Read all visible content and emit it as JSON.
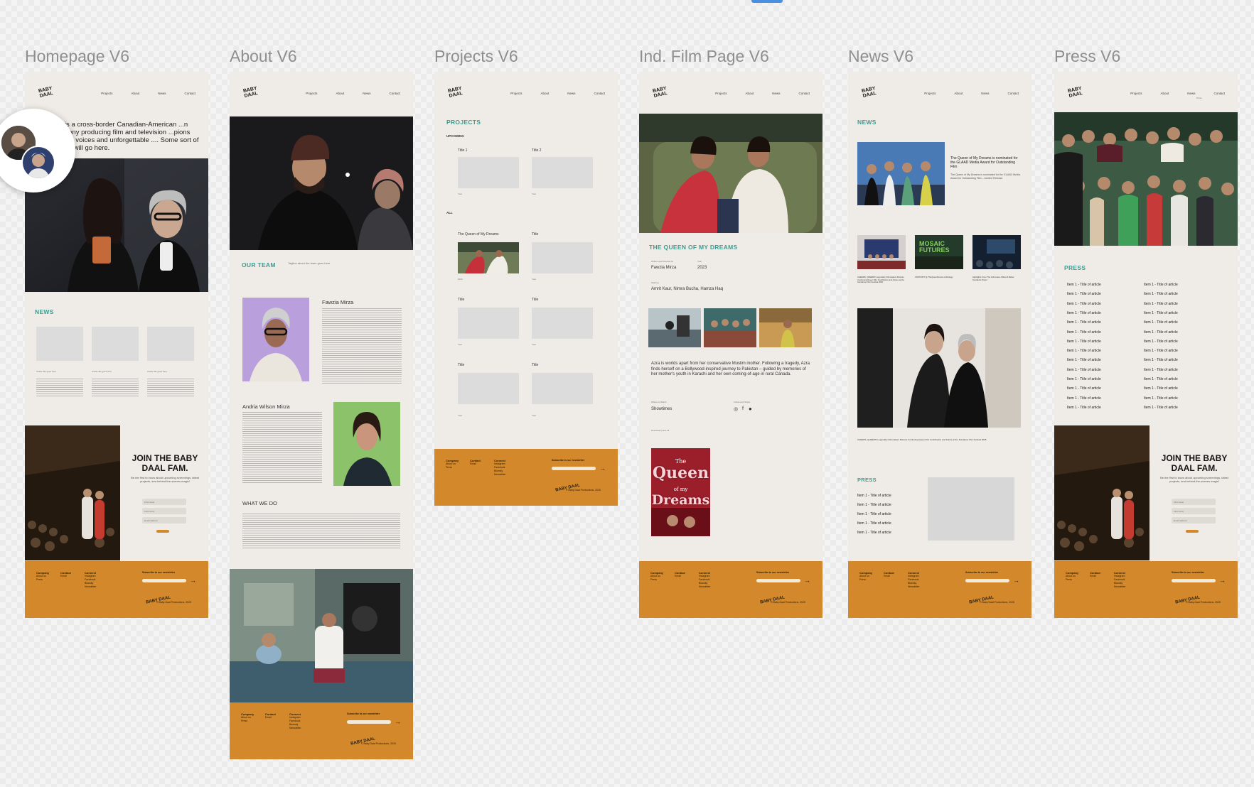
{
  "frames": {
    "homepage": {
      "title": "Homepage V6"
    },
    "about": {
      "title": "About V6"
    },
    "projects": {
      "title": "Projects V6"
    },
    "film": {
      "title": "Ind. Film Page V6"
    },
    "news": {
      "title": "News V6"
    },
    "press": {
      "title": "Press V6"
    }
  },
  "brand": {
    "logo": "BABY DAAL",
    "logo_line1": "BABY",
    "logo_line2": "DAAL"
  },
  "nav": {
    "projects": "Projects",
    "about": "About",
    "news": "News",
    "contact": "Contact"
  },
  "homepage": {
    "tagline": "...al is a cross-border Canadian-American ...n company producing film and television ...pions original voices and unforgettable .... Some sort of tagline will go here.",
    "news_heading": "NEWS",
    "news_item_title": "Article title goes here",
    "join_title": "JOIN THE BABY DAAL FAM.",
    "join_text": "Be the first to know about upcoming screenings, latest projects, and behind-the-scenes magic!",
    "field_first": "First name",
    "field_last": "Last name",
    "field_email": "Email address",
    "submit": "Subscribe"
  },
  "about": {
    "team_heading": "OUR TEAM",
    "team_tagline": "Tagline about the team goes here",
    "member1_name": "Fawzia Mirza",
    "member2_name": "Andria Wilson Mirza",
    "what_we_do": "WHAT WE DO"
  },
  "projects": {
    "heading": "PROJECTS",
    "upcoming": "UPCOMING",
    "all": "ALL",
    "title1": "Title 1",
    "title2": "Title 2",
    "queen_title": "The Queen of My Dreams",
    "title": "Title",
    "year": "Year",
    "queen_year": "2023"
  },
  "film": {
    "heading": "THE QUEEN OF MY DREAMS",
    "written_label": "Written and Directed by",
    "director": "Fawzia Mirza",
    "year_label": "Year",
    "year": "2023",
    "starring_label": "Starring",
    "cast": "Amrit Kaur, Nimra Bucha, Hamza Haq",
    "synopsis": "Azra is worlds apart from her conservative Muslim mother. Following a tragedy, Azra finds herself on a Bollywood-inspired journey to Pakistan – guided by memories of her mother's youth in Karachi and her own coming-of-age in rural Canada.",
    "where_label": "Where to Watch",
    "showtimes": "Showtimes",
    "follow_label": "Follow and Share",
    "download_label": "Download press kit",
    "poster_title_1": "The",
    "poster_title_2": "Queen",
    "poster_title_3": "of my",
    "poster_title_4": "Dreams"
  },
  "news": {
    "heading": "NEWS",
    "featured_title": "The Queen of My Dreams is nominated for the GLAAD Media Award for Outstanding Film",
    "featured_text": "The Queen of My Dreams is nominated for the GLAAD Media Award for Outstanding Film – Limited Release.",
    "card1": "CHEERS, QUEERS! Legendary Filmmakers Discuss Continuing Queer Film Contribution and Future at the Sundance Film Festival 2025",
    "card2": "UNITFORT @ TheQueerFutures Anthology",
    "card3": "Highlights From The Girls Have A Best & Better Sundance Panel",
    "wide_caption": "CHEERS, QUEERS! Legendary Filmmakers Discuss Continuing Queer Film Contribution and Future at the Sundance Film Festival 2025",
    "mosaic_sign": "MOSAIC FUTURES",
    "press_heading": "PRESS",
    "press_item": "Item 1 - Title of article"
  },
  "press": {
    "heading": "PRESS",
    "item": "Item 1 - Title of article",
    "nav_extra": "Press"
  },
  "footer": {
    "company": "Company",
    "company_links": "About us\nPress",
    "contact": "Contact",
    "contact_links": "Email",
    "connect": "Connect",
    "connect_links": "Instagram\nFacebook\nBluesky\nNewsletter",
    "subscribe": "Subscribe to our newsletter",
    "copyright": "© Baby Daal Productions, 2025"
  },
  "colors": {
    "accent_orange": "#d2882b",
    "teal": "#3f9c91",
    "cream": "#efebe6",
    "placeholder": "#dcdcdc"
  }
}
